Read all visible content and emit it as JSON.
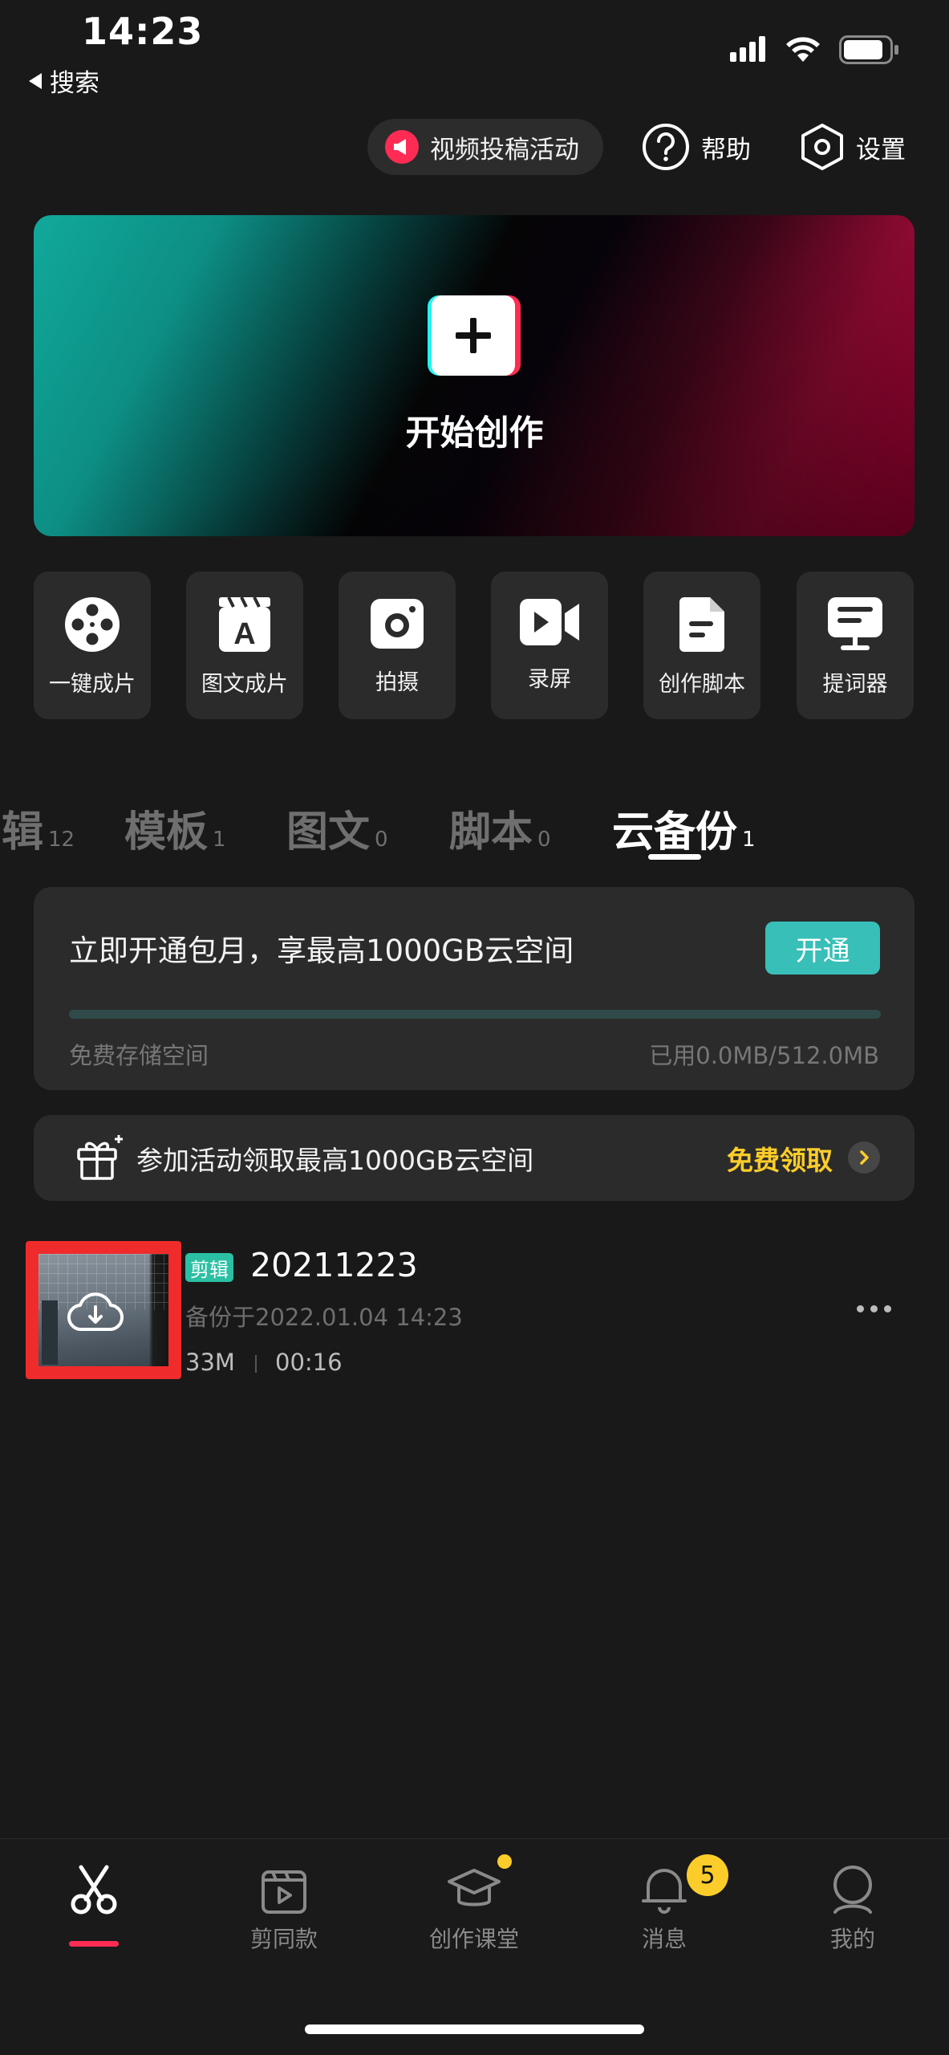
{
  "status_bar": {
    "time": "14:23",
    "back_label": "搜索"
  },
  "top_actions": {
    "promo": "视频投稿活动",
    "help": "帮助",
    "settings": "设置"
  },
  "hero": {
    "label": "开始创作"
  },
  "tools": [
    {
      "label": "一键成片",
      "icon": "film-reel-icon"
    },
    {
      "label": "图文成片",
      "icon": "clapper-a-icon"
    },
    {
      "label": "拍摄",
      "icon": "camera-icon"
    },
    {
      "label": "录屏",
      "icon": "video-camera-icon"
    },
    {
      "label": "创作脚本",
      "icon": "script-doc-icon"
    },
    {
      "label": "提词器",
      "icon": "teleprompter-icon"
    }
  ],
  "tabs": [
    {
      "label": "辑",
      "count": "12",
      "active": false
    },
    {
      "label": "模板",
      "count": "1",
      "active": false
    },
    {
      "label": "图文",
      "count": "0",
      "active": false
    },
    {
      "label": "脚本",
      "count": "0",
      "active": false
    },
    {
      "label": "云备份",
      "count": "1",
      "active": true
    }
  ],
  "cloud": {
    "title": "立即开通包月，享最高1000GB云空间",
    "open_button": "开通",
    "storage_label": "免费存储空间",
    "storage_used": "已用0.0MB/512.0MB",
    "used_fraction": 0.0
  },
  "event": {
    "text": "参加活动领取最高1000GB云空间",
    "cta": "免费领取"
  },
  "project": {
    "tag": "剪辑",
    "name": "20211223",
    "backup_time": "备份于2022.01.04 14:23",
    "size": "33M",
    "duration": "00:16"
  },
  "bottom_nav": {
    "items": [
      {
        "label": "",
        "icon": "scissors-icon",
        "active": true
      },
      {
        "label": "剪同款",
        "icon": "template-play-icon"
      },
      {
        "label": "创作课堂",
        "icon": "graduation-cap-icon"
      },
      {
        "label": "消息",
        "icon": "bell-icon"
      },
      {
        "label": "我的",
        "icon": "profile-icon"
      }
    ],
    "message_badge": "5"
  },
  "colors": {
    "accent_teal": "#38bfb7",
    "accent_red": "#fe2c55",
    "accent_yellow": "#fccd2a",
    "background": "#191919"
  }
}
